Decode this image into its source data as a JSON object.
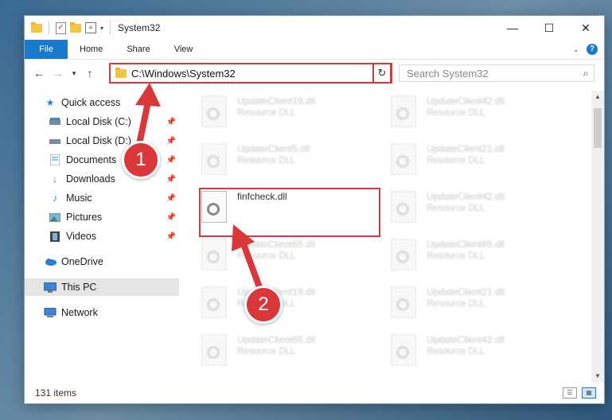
{
  "window": {
    "title": "System32",
    "controls": {
      "minimize": "—",
      "maximize": "☐",
      "close": "✕"
    }
  },
  "ribbon": {
    "tabs": [
      "File",
      "Home",
      "Share",
      "View"
    ],
    "collapse_icon": "chevron-down-icon",
    "help_label": "?"
  },
  "navigation": {
    "address": "C:\\Windows\\System32",
    "search_placeholder": "Search System32"
  },
  "sidebar": {
    "items": [
      {
        "label": "Quick access",
        "icon": "star-icon",
        "pinned": false
      },
      {
        "label": "Local Disk (C:)",
        "icon": "drive-icon",
        "pinned": true
      },
      {
        "label": "Local Disk (D:)",
        "icon": "drive-icon",
        "pinned": true
      },
      {
        "label": "Documents",
        "icon": "documents-icon",
        "pinned": true
      },
      {
        "label": "Downloads",
        "icon": "download-icon",
        "pinned": true
      },
      {
        "label": "Music",
        "icon": "music-icon",
        "pinned": true
      },
      {
        "label": "Pictures",
        "icon": "pictures-icon",
        "pinned": true
      },
      {
        "label": "Videos",
        "icon": "videos-icon",
        "pinned": true
      },
      {
        "label": "OneDrive",
        "icon": "cloud-icon",
        "pinned": false
      },
      {
        "label": "This PC",
        "icon": "computer-icon",
        "pinned": false,
        "selected": true
      },
      {
        "label": "Network",
        "icon": "network-icon",
        "pinned": false
      }
    ]
  },
  "files": {
    "left": [
      {
        "name": "UpdateClient19.dll",
        "type": "Resource DLL"
      },
      {
        "name": "UpdateClient5.dll",
        "type": "Resource DLL"
      },
      {
        "name": "finfcheck.dll",
        "type": "",
        "highlighted": true
      },
      {
        "name": "UpdateClient65.dll",
        "type": "Resource DLL"
      },
      {
        "name": "UpdateClient19.dll",
        "type": "Resource DLL"
      },
      {
        "name": "UpdateClient65.dll",
        "type": "Resource DLL"
      }
    ],
    "right": [
      {
        "name": "UpdateClient42.dll",
        "type": "Resource DLL"
      },
      {
        "name": "UpdateClient21.dll",
        "type": "Resource DLL"
      },
      {
        "name": "UpdateClient42.dll",
        "type": "Resource DLL"
      },
      {
        "name": "UpdateClient65.dll",
        "type": "Resource DLL"
      },
      {
        "name": "UpdateClient21.dll",
        "type": "Resource DLL"
      },
      {
        "name": "UpdateClient42.dll",
        "type": "Resource DLL"
      }
    ]
  },
  "status": {
    "item_count": "131 items"
  },
  "callouts": {
    "step1": "1",
    "step2": "2"
  },
  "colors": {
    "accent": "#1979ca",
    "highlight": "#d2393a",
    "callout": "#d9373a"
  }
}
